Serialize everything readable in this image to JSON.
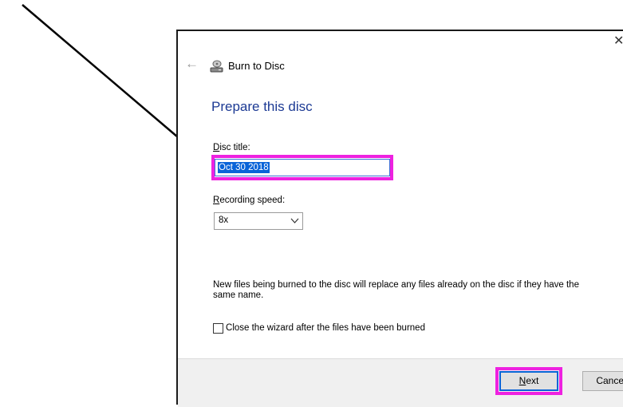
{
  "window": {
    "title": "Burn to Disc",
    "close_glyph": "✕",
    "back_glyph": "←",
    "icons": {
      "title": "disc-drive-icon",
      "back": "back-arrow-icon",
      "close": "close-icon"
    }
  },
  "page": {
    "heading": "Prepare this disc"
  },
  "disc_title": {
    "label_accel": "D",
    "label_rest": "isc title:",
    "value": "Oct 30 2018"
  },
  "recording_speed": {
    "label_accel": "R",
    "label_rest": "ecording speed:",
    "selected": "8x"
  },
  "notice": "New files being burned to the disc will replace any files already on the disc if they have the same name.",
  "close_wizard": {
    "checked": false,
    "label_accel": "C",
    "label_rest": "lose the wizard after the files have been burned"
  },
  "buttons": {
    "next_accel": "N",
    "next_rest": "ext",
    "cancel": "Cancel"
  },
  "annotations": {
    "highlight_color": "#ee22e0",
    "arrow_color": "#000000"
  }
}
